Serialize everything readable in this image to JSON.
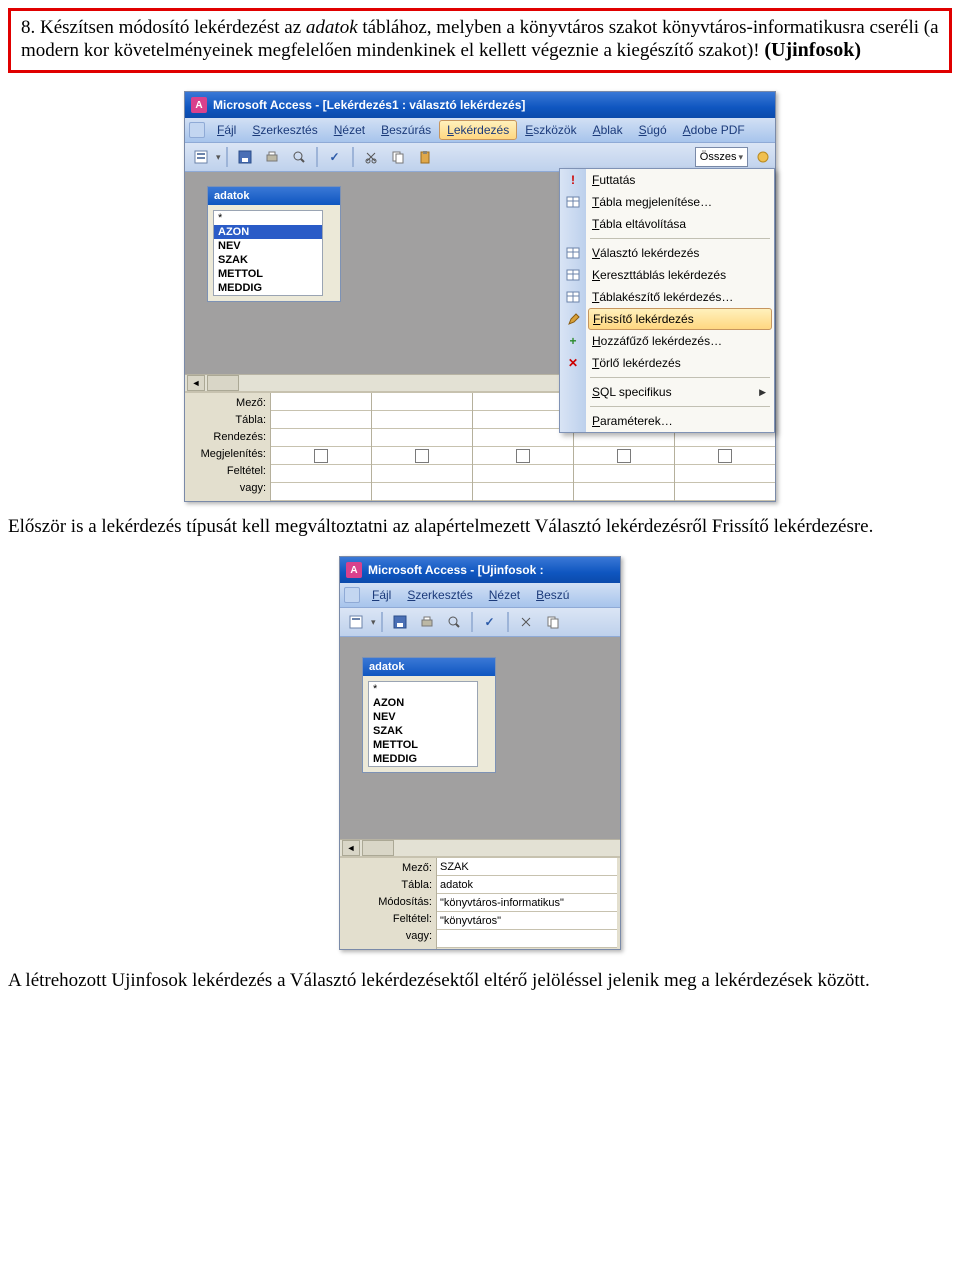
{
  "task": {
    "prefix": "8. Készítsen módosító lekérdezést az ",
    "italic_table": "adatok",
    "mid1": " táblához, melyben a könyvtáros szakot könyvtáros-informatikusra cseréli (a modern kor követelményeinek megfelelően mindenkinek el kellett végeznie a kiegészítő szakot)! ",
    "bold_name": "(Ujinfosok)"
  },
  "para1": "Először is a lekérdezés típusát kell megváltoztatni az alapértelmezett Választó lekérdezésről Frissítő lekérdezésre.",
  "para2": "A létrehozott Ujinfosok lekérdezés a Választó lekérdezésektől eltérő jelöléssel jelenik meg a lekérdezések között.",
  "screenshot1": {
    "title": "Microsoft Access - [Lekérdezés1 : választó lekérdezés]",
    "menus": [
      "Fájl",
      "Szerkesztés",
      "Nézet",
      "Beszúrás",
      "Lekérdezés",
      "Eszközök",
      "Ablak",
      "Súgó",
      "Adobe PDF"
    ],
    "menu_active_index": 4,
    "osszes": "Összes",
    "table_box_title": "adatok",
    "fields": [
      "*",
      "AZON",
      "NEV",
      "SZAK",
      "METTOL",
      "MEDDIG"
    ],
    "selected_field": "AZON",
    "grid_labels": [
      "Mező:",
      "Tábla:",
      "Rendezés:",
      "Megjelenítés:",
      "Feltétel:",
      "vagy:"
    ],
    "dropdown": [
      {
        "label": "Futtatás",
        "icon": "!",
        "sep_after": false
      },
      {
        "label": "Tábla megjelenítése…",
        "icon": "tbl",
        "sep_after": false
      },
      {
        "label": "Tábla eltávolítása",
        "icon": "",
        "sep_after": true
      },
      {
        "label": "Választó lekérdezés",
        "icon": "sq",
        "sep_after": false
      },
      {
        "label": "Kereszttáblás lekérdezés",
        "icon": "ct",
        "sep_after": false
      },
      {
        "label": "Táblakészítő lekérdezés…",
        "icon": "tc",
        "sep_after": false
      },
      {
        "label": "Frissítő lekérdezés",
        "icon": "pen",
        "sep_after": false,
        "hover": true
      },
      {
        "label": "Hozzáfűző lekérdezés…",
        "icon": "+",
        "sep_after": false
      },
      {
        "label": "Törlő lekérdezés",
        "icon": "x",
        "sep_after": true
      },
      {
        "label": "SQL specifikus",
        "icon": "",
        "arrow": true,
        "sep_after": true
      },
      {
        "label": "Paraméterek…",
        "icon": "",
        "sep_after": false
      }
    ]
  },
  "screenshot2": {
    "title": "Microsoft Access - [Ujinfosok :",
    "menus": [
      "Fájl",
      "Szerkesztés",
      "Nézet",
      "Beszú"
    ],
    "table_box_title": "adatok",
    "fields": [
      "*",
      "AZON",
      "NEV",
      "SZAK",
      "METTOL",
      "MEDDIG"
    ],
    "grid_labels": [
      "Mező:",
      "Tábla:",
      "Módosítás:",
      "Feltétel:",
      "vagy:"
    ],
    "grid_values": [
      "SZAK",
      "adatok",
      "\"könyvtáros-informatikus\"",
      "\"könyvtáros\"",
      ""
    ]
  }
}
